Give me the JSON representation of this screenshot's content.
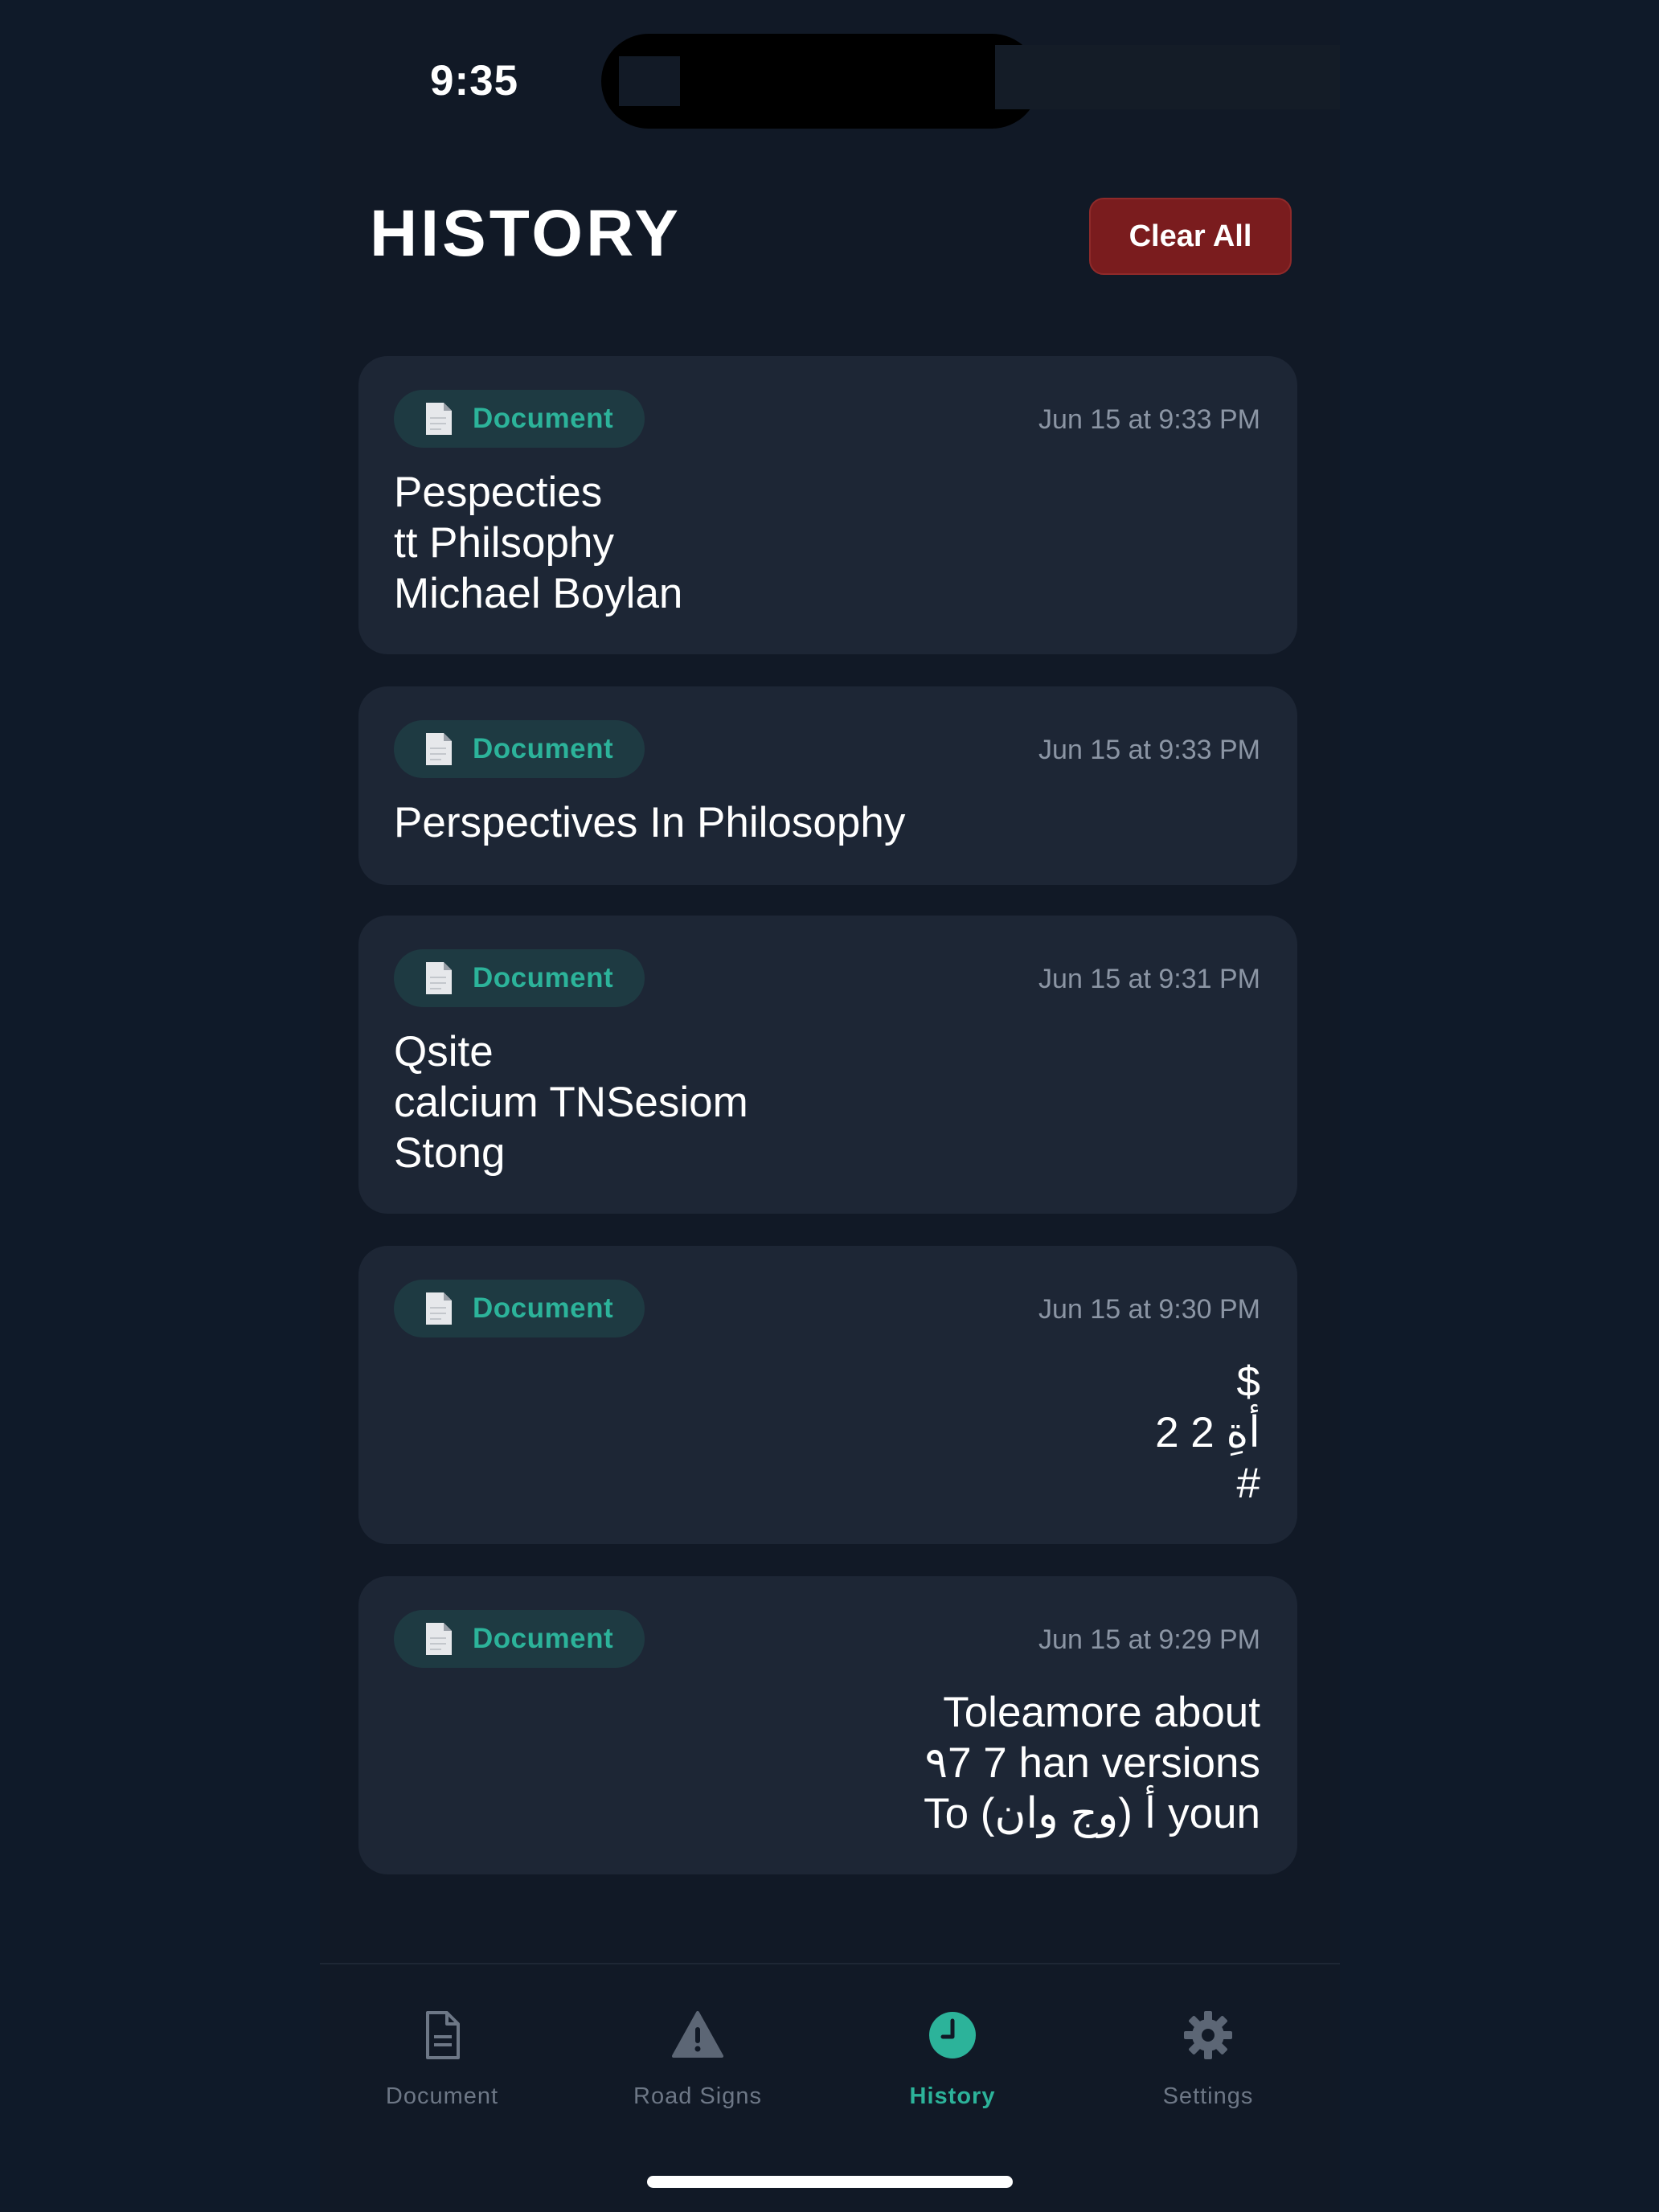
{
  "status_bar": {
    "time": "9:35"
  },
  "header": {
    "title": "HISTORY",
    "clear_all_label": "Clear All"
  },
  "history": [
    {
      "type_label": "Document",
      "timestamp": "Jun 15 at 9:33 PM",
      "text": "Pespecties\ntt Philsophy\nMichael Boylan",
      "direction": "ltr"
    },
    {
      "type_label": "Document",
      "timestamp": "Jun 15 at 9:33 PM",
      "text": "Perspectives In Philosophy",
      "direction": "ltr"
    },
    {
      "type_label": "Document",
      "timestamp": "Jun 15 at 9:31 PM",
      "text": "Qsite\ncalcium TNSesiom\nStong",
      "direction": "ltr"
    },
    {
      "type_label": "Document",
      "timestamp": "Jun 15 at 9:30 PM",
      "text": "$\nأةِ 2 2\n#",
      "direction": "rtl"
    },
    {
      "type_label": "Document",
      "timestamp": "Jun 15 at 9:29 PM",
      "text": "Toleamore about\n٩7 7 han versions\nTo (أ (وج وان youn",
      "direction": "rtl"
    }
  ],
  "tabs": [
    {
      "label": "Document",
      "icon": "document-icon",
      "active": false
    },
    {
      "label": "Road Signs",
      "icon": "warning-triangle-icon",
      "active": false
    },
    {
      "label": "History",
      "icon": "clock-icon",
      "active": true
    },
    {
      "label": "Settings",
      "icon": "gear-icon",
      "active": false
    }
  ],
  "colors": {
    "background": "#111926",
    "card": "#1d2635",
    "accent": "#2cb39a",
    "danger": "#7a1c1e",
    "muted": "#6d7786"
  }
}
